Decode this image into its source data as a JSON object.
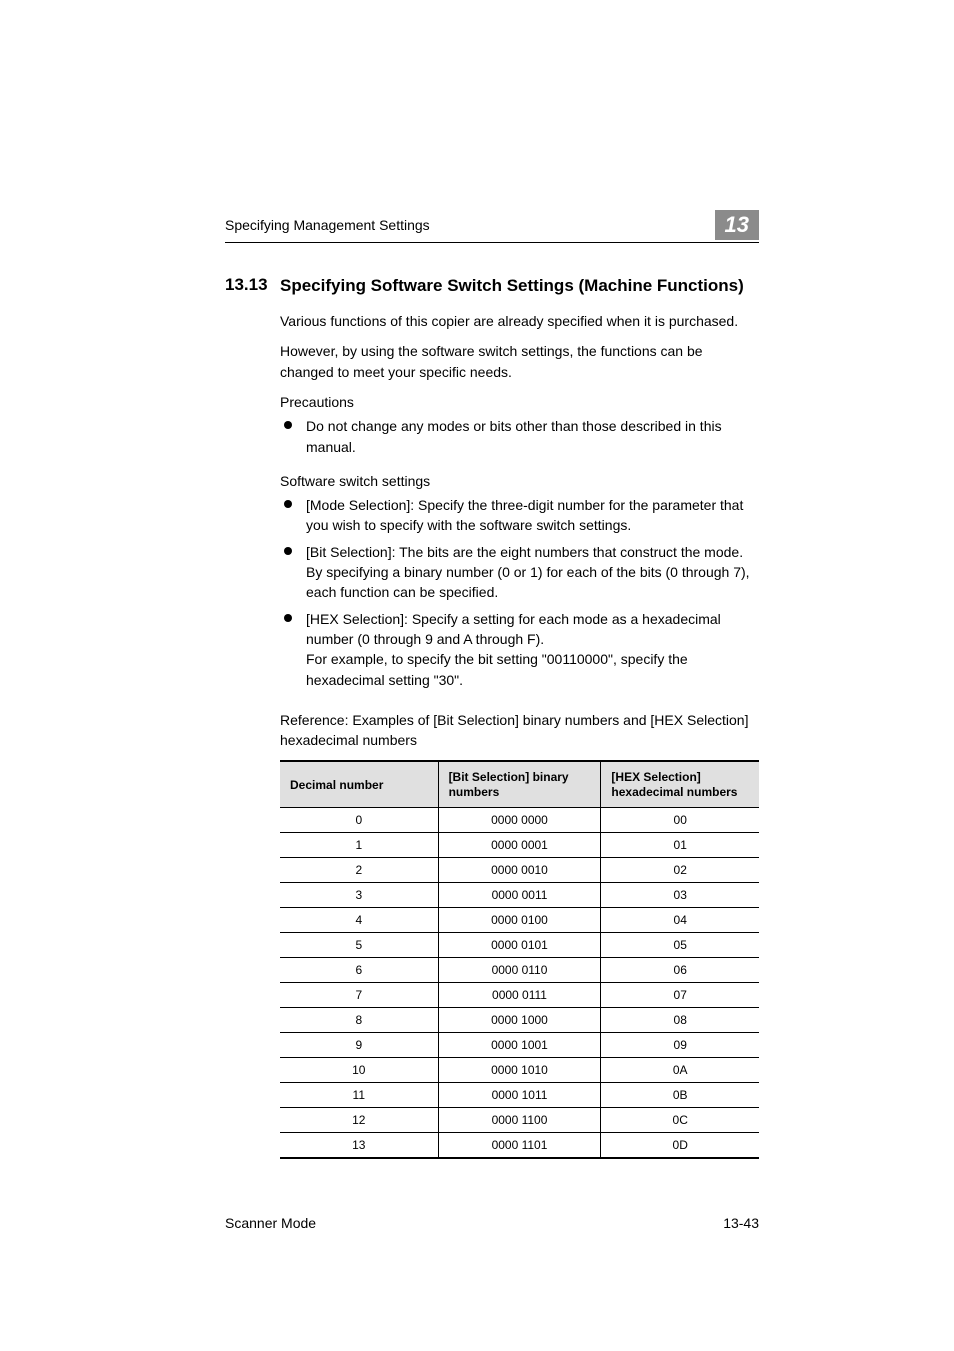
{
  "header": {
    "running_head": "Specifying Management Settings",
    "chapter": "13"
  },
  "section": {
    "number": "13.13",
    "title": "Specifying Software Switch Settings (Machine Functions)"
  },
  "body": {
    "p1": "Various functions of this copier are already specified when it is purchased.",
    "p2": "However, by using the software switch settings, the functions can be changed to meet your specific needs.",
    "precautions_label": "Precautions",
    "precautions_item": "Do not change any modes or bits other than those described in this manual.",
    "sss_label": "Software switch settings",
    "sss_items": {
      "mode": "[Mode Selection]: Specify the three-digit number for the parameter that you wish to specify with the software switch settings.",
      "bit": "[Bit Selection]: The bits are the eight numbers that construct the mode. By specifying a binary number (0 or 1) for each of the bits (0 through 7), each function can be specified.",
      "hex": "[HEX Selection]: Specify a setting for each mode as a hexadecimal number (0 through 9 and A through F).\nFor example, to specify the bit setting \"00110000\", specify the hexadecimal setting \"30\"."
    },
    "reference_label": "Reference: Examples of [Bit Selection] binary numbers and [HEX Selection] hexadecimal numbers"
  },
  "table": {
    "headers": {
      "dec": "Decimal number",
      "bit": "[Bit Selection] binary numbers",
      "hex": "[HEX Selection] hexadecimal numbers"
    },
    "rows": [
      {
        "dec": "0",
        "bit": "0000 0000",
        "hex": "00"
      },
      {
        "dec": "1",
        "bit": "0000 0001",
        "hex": "01"
      },
      {
        "dec": "2",
        "bit": "0000 0010",
        "hex": "02"
      },
      {
        "dec": "3",
        "bit": "0000 0011",
        "hex": "03"
      },
      {
        "dec": "4",
        "bit": "0000 0100",
        "hex": "04"
      },
      {
        "dec": "5",
        "bit": "0000 0101",
        "hex": "05"
      },
      {
        "dec": "6",
        "bit": "0000 0110",
        "hex": "06"
      },
      {
        "dec": "7",
        "bit": "0000 0111",
        "hex": "07"
      },
      {
        "dec": "8",
        "bit": "0000 1000",
        "hex": "08"
      },
      {
        "dec": "9",
        "bit": "0000 1001",
        "hex": "09"
      },
      {
        "dec": "10",
        "bit": "0000 1010",
        "hex": "0A"
      },
      {
        "dec": "11",
        "bit": "0000 1011",
        "hex": "0B"
      },
      {
        "dec": "12",
        "bit": "0000 1100",
        "hex": "0C"
      },
      {
        "dec": "13",
        "bit": "0000 1101",
        "hex": "0D"
      }
    ]
  },
  "footer": {
    "left": "Scanner Mode",
    "right": "13-43"
  }
}
